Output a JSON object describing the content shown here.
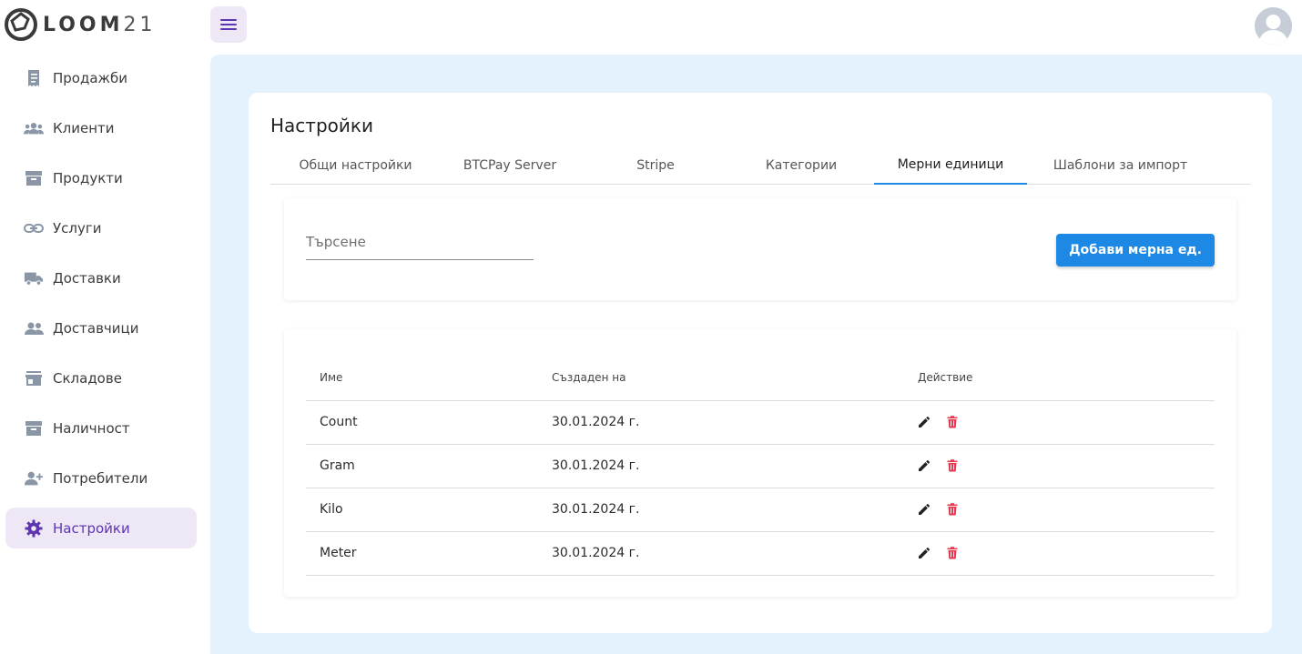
{
  "brand": {
    "name": "LOOM",
    "suffix": "21"
  },
  "sidebar": {
    "items": [
      {
        "label": "Продажби",
        "icon": "receipt-icon",
        "active": false
      },
      {
        "label": "Клиенти",
        "icon": "people-group-icon",
        "active": false
      },
      {
        "label": "Продукти",
        "icon": "archive-box-icon",
        "active": false
      },
      {
        "label": "Услуги",
        "icon": "link-icon",
        "active": false
      },
      {
        "label": "Доставки",
        "icon": "truck-icon",
        "active": false
      },
      {
        "label": "Доставчици",
        "icon": "people-icon",
        "active": false
      },
      {
        "label": "Складове",
        "icon": "store-icon",
        "active": false
      },
      {
        "label": "Наличност",
        "icon": "archive-box-icon",
        "active": false
      },
      {
        "label": "Потребители",
        "icon": "person-add-icon",
        "active": false
      },
      {
        "label": "Настройки",
        "icon": "gear-icon",
        "active": true
      }
    ]
  },
  "page": {
    "title": "Настройки"
  },
  "tabs": [
    {
      "label": "Общи настройки",
      "active": false
    },
    {
      "label": "BTCPay Server",
      "active": false
    },
    {
      "label": "Stripe",
      "active": false
    },
    {
      "label": "Категории",
      "active": false
    },
    {
      "label": "Мерни единици",
      "active": true
    },
    {
      "label": "Шаблони за импорт",
      "active": false
    }
  ],
  "search": {
    "placeholder": "Търсене"
  },
  "add_button": {
    "label": "Добави мерна ед."
  },
  "table": {
    "headers": {
      "name": "Име",
      "created": "Създаден на",
      "actions": "Действие"
    },
    "rows": [
      {
        "name": "Count",
        "created": "30.01.2024 г."
      },
      {
        "name": "Gram",
        "created": "30.01.2024 г."
      },
      {
        "name": "Kilo",
        "created": "30.01.2024 г."
      },
      {
        "name": "Meter",
        "created": "30.01.2024 г."
      }
    ]
  },
  "colors": {
    "accent": "#5e35b1",
    "accent_bg": "#ede7f6",
    "primary": "#1e88e5",
    "main_bg": "#e3f2fd",
    "delete": "#e53950"
  }
}
